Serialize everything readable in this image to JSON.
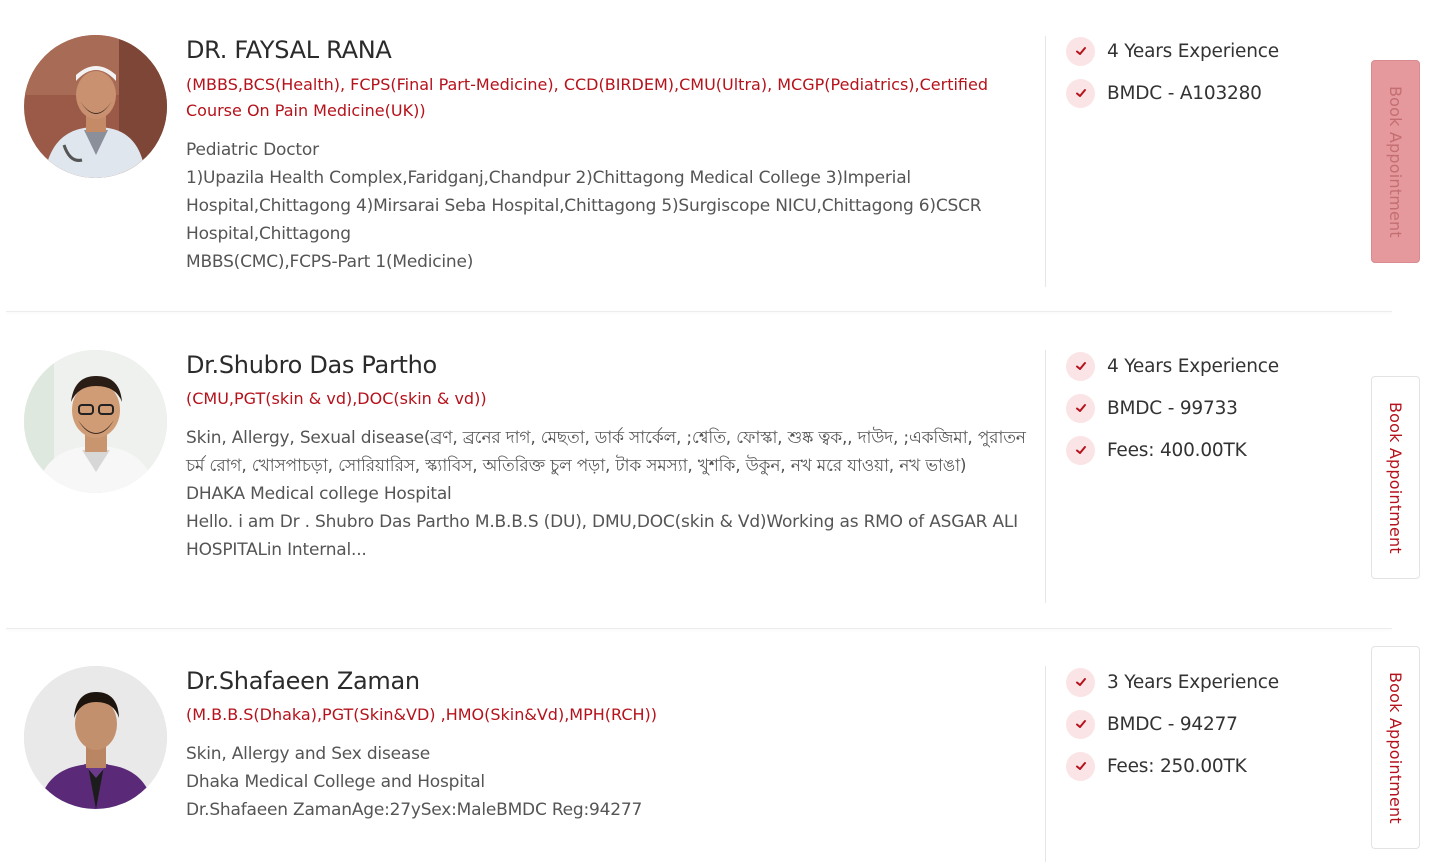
{
  "doctors": [
    {
      "name": "DR. FAYSAL RANA",
      "degrees": "(MBBS,BCS(Health), FCPS(Final Part-Medicine), CCD(BIRDEM),CMU(Ultra), MCGP(Pediatrics),Certified Course On Pain Medicine(UK))",
      "specialty": "Pediatric Doctor",
      "hospital": "1)Upazila Health Complex,Faridganj,Chandpur 2)Chittagong Medical College 3)Imperial Hospital,Chittagong 4)Mirsarai Seba Hospital,Chittagong 5)Surgiscope NICU,Chittagong 6)CSCR Hospital,Chittagong",
      "about": "MBBS(CMC),FCPS-Part 1(Medicine)",
      "experience": "4 Years Experience",
      "bmdc": "BMDC - A103280",
      "book_label": "Book Appointment"
    },
    {
      "name": "Dr.Shubro Das Partho",
      "degrees": "(CMU,PGT(skin & vd),DOC(skin & vd))",
      "specialty": "Skin, Allergy, Sexual disease(ব্রণ, ব্রনের দাগ, মেছতা, ডার্ক সার্কেল, ;শ্বেতি, ফোস্কা, শুষ্ক ত্বক,, দাউদ, ;একজিমা, পুরাতন চর্ম রোগ, খোসপাচড়া, সোরিয়ারিস, স্ক্যাবিস, অতিরিক্ত চুল পড়া, টাক সমস্যা, খুশকি, উকুন, নখ মরে যাওয়া, নখ ভাঙা)",
      "hospital": "DHAKA Medical college Hospital",
      "about": "Hello. i am Dr . Shubro Das Partho M.B.B.S (DU), DMU,DOC(skin & Vd)Working as RMO of ASGAR ALI HOSPITALin Internal...",
      "experience": "4 Years Experience",
      "bmdc": "BMDC - 99733",
      "fees": "Fees: 400.00TK",
      "book_label": "Book Appointment"
    },
    {
      "name": "Dr.Shafaeen Zaman",
      "degrees": "(M.B.B.S(Dhaka),PGT(Skin&VD) ,HMO(Skin&Vd),MPH(RCH))",
      "specialty": "Skin, Allergy and Sex disease",
      "hospital": "Dhaka Medical College and Hospital",
      "about": "Dr.Shafaeen ZamanAge:27ySex:MaleBMDC Reg:94277",
      "experience": "3 Years Experience",
      "bmdc": "BMDC - 94277",
      "fees": "Fees: 250.00TK",
      "book_label": "Book Appointment"
    }
  ],
  "colors": {
    "accent": "#b5121b",
    "check_bg": "#fbe4e5",
    "faded_button": "#e5999c"
  },
  "icons": {
    "check": "check-icon",
    "avatar": "doctor-photo"
  }
}
